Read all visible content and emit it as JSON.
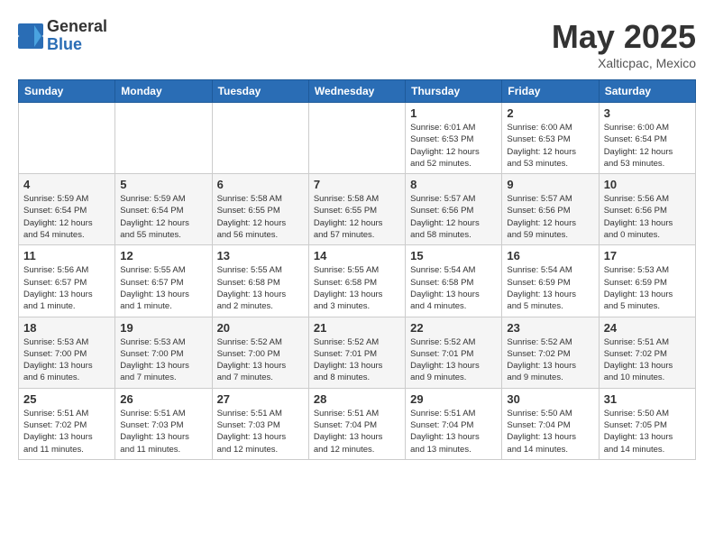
{
  "header": {
    "logo_general": "General",
    "logo_blue": "Blue",
    "title": "May 2025",
    "location": "Xalticpac, Mexico"
  },
  "weekdays": [
    "Sunday",
    "Monday",
    "Tuesday",
    "Wednesday",
    "Thursday",
    "Friday",
    "Saturday"
  ],
  "weeks": [
    [
      {
        "day": "",
        "info": ""
      },
      {
        "day": "",
        "info": ""
      },
      {
        "day": "",
        "info": ""
      },
      {
        "day": "",
        "info": ""
      },
      {
        "day": "1",
        "info": "Sunrise: 6:01 AM\nSunset: 6:53 PM\nDaylight: 12 hours\nand 52 minutes."
      },
      {
        "day": "2",
        "info": "Sunrise: 6:00 AM\nSunset: 6:53 PM\nDaylight: 12 hours\nand 53 minutes."
      },
      {
        "day": "3",
        "info": "Sunrise: 6:00 AM\nSunset: 6:54 PM\nDaylight: 12 hours\nand 53 minutes."
      }
    ],
    [
      {
        "day": "4",
        "info": "Sunrise: 5:59 AM\nSunset: 6:54 PM\nDaylight: 12 hours\nand 54 minutes."
      },
      {
        "day": "5",
        "info": "Sunrise: 5:59 AM\nSunset: 6:54 PM\nDaylight: 12 hours\nand 55 minutes."
      },
      {
        "day": "6",
        "info": "Sunrise: 5:58 AM\nSunset: 6:55 PM\nDaylight: 12 hours\nand 56 minutes."
      },
      {
        "day": "7",
        "info": "Sunrise: 5:58 AM\nSunset: 6:55 PM\nDaylight: 12 hours\nand 57 minutes."
      },
      {
        "day": "8",
        "info": "Sunrise: 5:57 AM\nSunset: 6:56 PM\nDaylight: 12 hours\nand 58 minutes."
      },
      {
        "day": "9",
        "info": "Sunrise: 5:57 AM\nSunset: 6:56 PM\nDaylight: 12 hours\nand 59 minutes."
      },
      {
        "day": "10",
        "info": "Sunrise: 5:56 AM\nSunset: 6:56 PM\nDaylight: 13 hours\nand 0 minutes."
      }
    ],
    [
      {
        "day": "11",
        "info": "Sunrise: 5:56 AM\nSunset: 6:57 PM\nDaylight: 13 hours\nand 1 minute."
      },
      {
        "day": "12",
        "info": "Sunrise: 5:55 AM\nSunset: 6:57 PM\nDaylight: 13 hours\nand 1 minute."
      },
      {
        "day": "13",
        "info": "Sunrise: 5:55 AM\nSunset: 6:58 PM\nDaylight: 13 hours\nand 2 minutes."
      },
      {
        "day": "14",
        "info": "Sunrise: 5:55 AM\nSunset: 6:58 PM\nDaylight: 13 hours\nand 3 minutes."
      },
      {
        "day": "15",
        "info": "Sunrise: 5:54 AM\nSunset: 6:58 PM\nDaylight: 13 hours\nand 4 minutes."
      },
      {
        "day": "16",
        "info": "Sunrise: 5:54 AM\nSunset: 6:59 PM\nDaylight: 13 hours\nand 5 minutes."
      },
      {
        "day": "17",
        "info": "Sunrise: 5:53 AM\nSunset: 6:59 PM\nDaylight: 13 hours\nand 5 minutes."
      }
    ],
    [
      {
        "day": "18",
        "info": "Sunrise: 5:53 AM\nSunset: 7:00 PM\nDaylight: 13 hours\nand 6 minutes."
      },
      {
        "day": "19",
        "info": "Sunrise: 5:53 AM\nSunset: 7:00 PM\nDaylight: 13 hours\nand 7 minutes."
      },
      {
        "day": "20",
        "info": "Sunrise: 5:52 AM\nSunset: 7:00 PM\nDaylight: 13 hours\nand 7 minutes."
      },
      {
        "day": "21",
        "info": "Sunrise: 5:52 AM\nSunset: 7:01 PM\nDaylight: 13 hours\nand 8 minutes."
      },
      {
        "day": "22",
        "info": "Sunrise: 5:52 AM\nSunset: 7:01 PM\nDaylight: 13 hours\nand 9 minutes."
      },
      {
        "day": "23",
        "info": "Sunrise: 5:52 AM\nSunset: 7:02 PM\nDaylight: 13 hours\nand 9 minutes."
      },
      {
        "day": "24",
        "info": "Sunrise: 5:51 AM\nSunset: 7:02 PM\nDaylight: 13 hours\nand 10 minutes."
      }
    ],
    [
      {
        "day": "25",
        "info": "Sunrise: 5:51 AM\nSunset: 7:02 PM\nDaylight: 13 hours\nand 11 minutes."
      },
      {
        "day": "26",
        "info": "Sunrise: 5:51 AM\nSunset: 7:03 PM\nDaylight: 13 hours\nand 11 minutes."
      },
      {
        "day": "27",
        "info": "Sunrise: 5:51 AM\nSunset: 7:03 PM\nDaylight: 13 hours\nand 12 minutes."
      },
      {
        "day": "28",
        "info": "Sunrise: 5:51 AM\nSunset: 7:04 PM\nDaylight: 13 hours\nand 12 minutes."
      },
      {
        "day": "29",
        "info": "Sunrise: 5:51 AM\nSunset: 7:04 PM\nDaylight: 13 hours\nand 13 minutes."
      },
      {
        "day": "30",
        "info": "Sunrise: 5:50 AM\nSunset: 7:04 PM\nDaylight: 13 hours\nand 14 minutes."
      },
      {
        "day": "31",
        "info": "Sunrise: 5:50 AM\nSunset: 7:05 PM\nDaylight: 13 hours\nand 14 minutes."
      }
    ]
  ]
}
